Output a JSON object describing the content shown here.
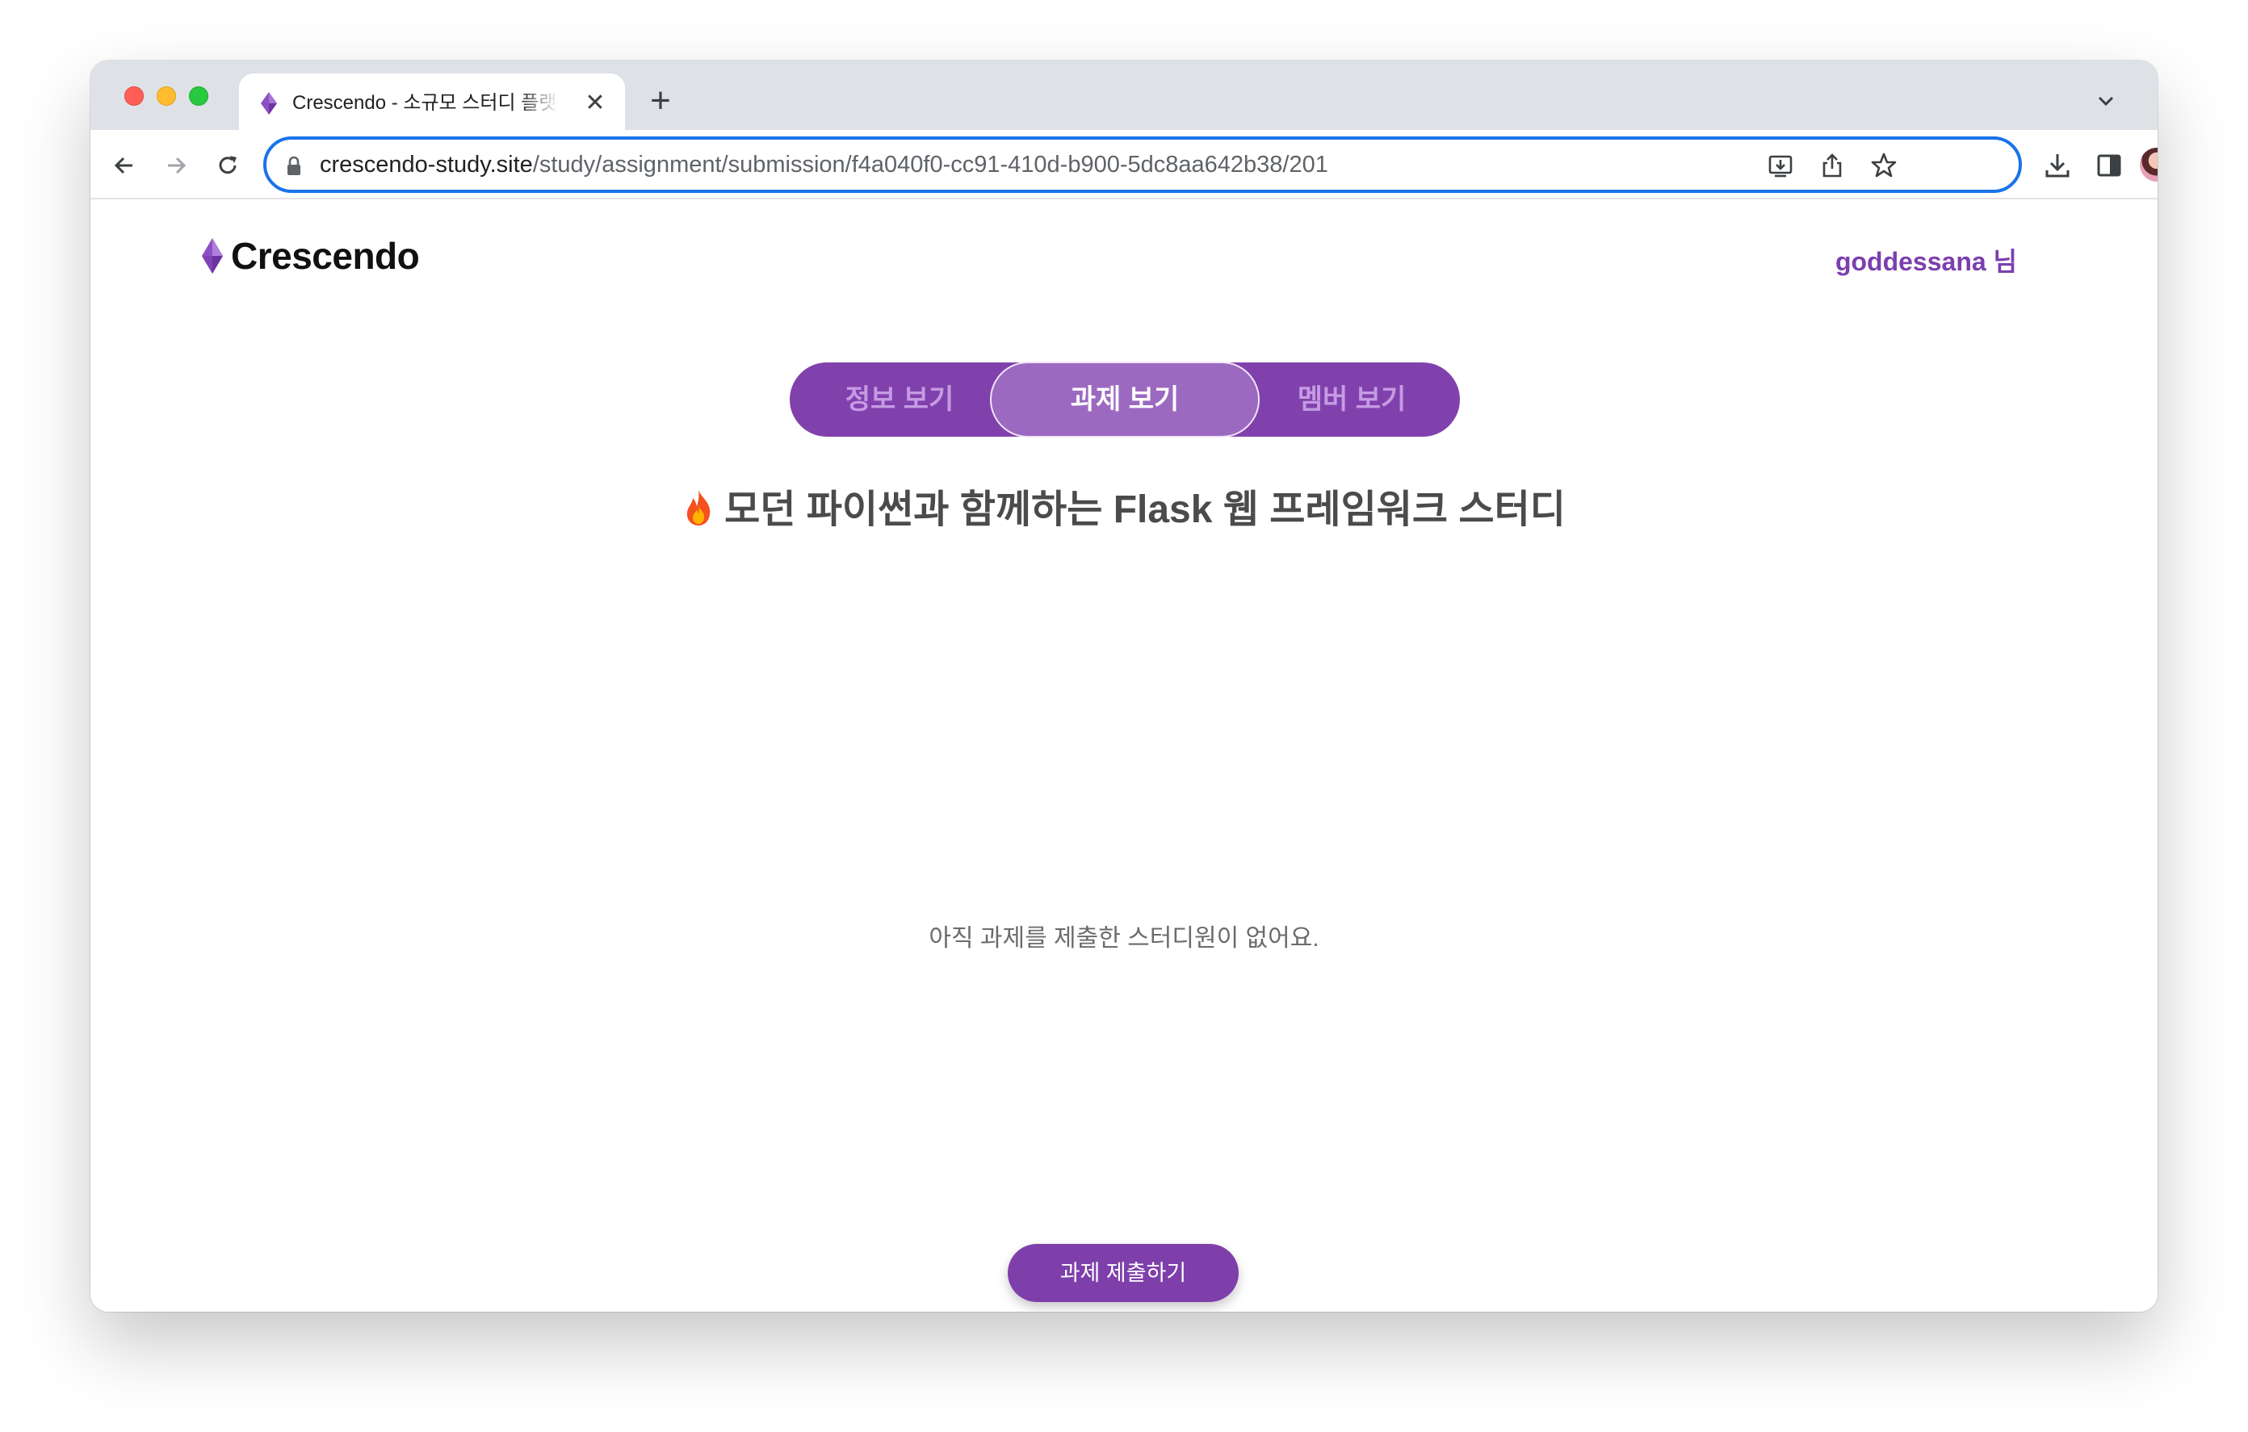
{
  "browser": {
    "tab_title": "Crescendo - 소규모 스터디 플랫폼",
    "tab_close": "✕",
    "new_tab": "+",
    "url_host": "crescendo-study.site",
    "url_path": "/study/assignment/submission/f4a040f0-cc91-410d-b900-5dc8aa642b38/201"
  },
  "header": {
    "logo_text": "Crescendo",
    "user_name": "goddessana 님"
  },
  "tabs": {
    "info": "정보 보기",
    "assignment": "과제 보기",
    "member": "멤버 보기",
    "active": "과제 보기"
  },
  "study": {
    "title": "모던 파이썬과 함께하는 Flask 웹 프레임워크 스터디"
  },
  "content": {
    "empty_message": "아직 과제를 제출한 스터디원이 없어요.",
    "submit_button": "과제 제출하기"
  },
  "colors": {
    "brand": "#7e3fab",
    "tab_active": "#9c69c0",
    "tab_inactive_text": "#c59be3",
    "url_focus": "#1a73e8"
  },
  "icons": {
    "back": "arrow-left-icon",
    "forward": "arrow-right-icon",
    "reload": "reload-icon",
    "lock": "lock-icon",
    "install": "install-icon",
    "share": "share-icon",
    "bookmark": "star-icon",
    "downloads": "download-icon",
    "side_panel": "side-panel-icon",
    "menu": "kebab-menu-icon",
    "tab_search": "chevron-down-icon",
    "logo": "diamond-logo-icon",
    "flame": "fire-icon"
  }
}
